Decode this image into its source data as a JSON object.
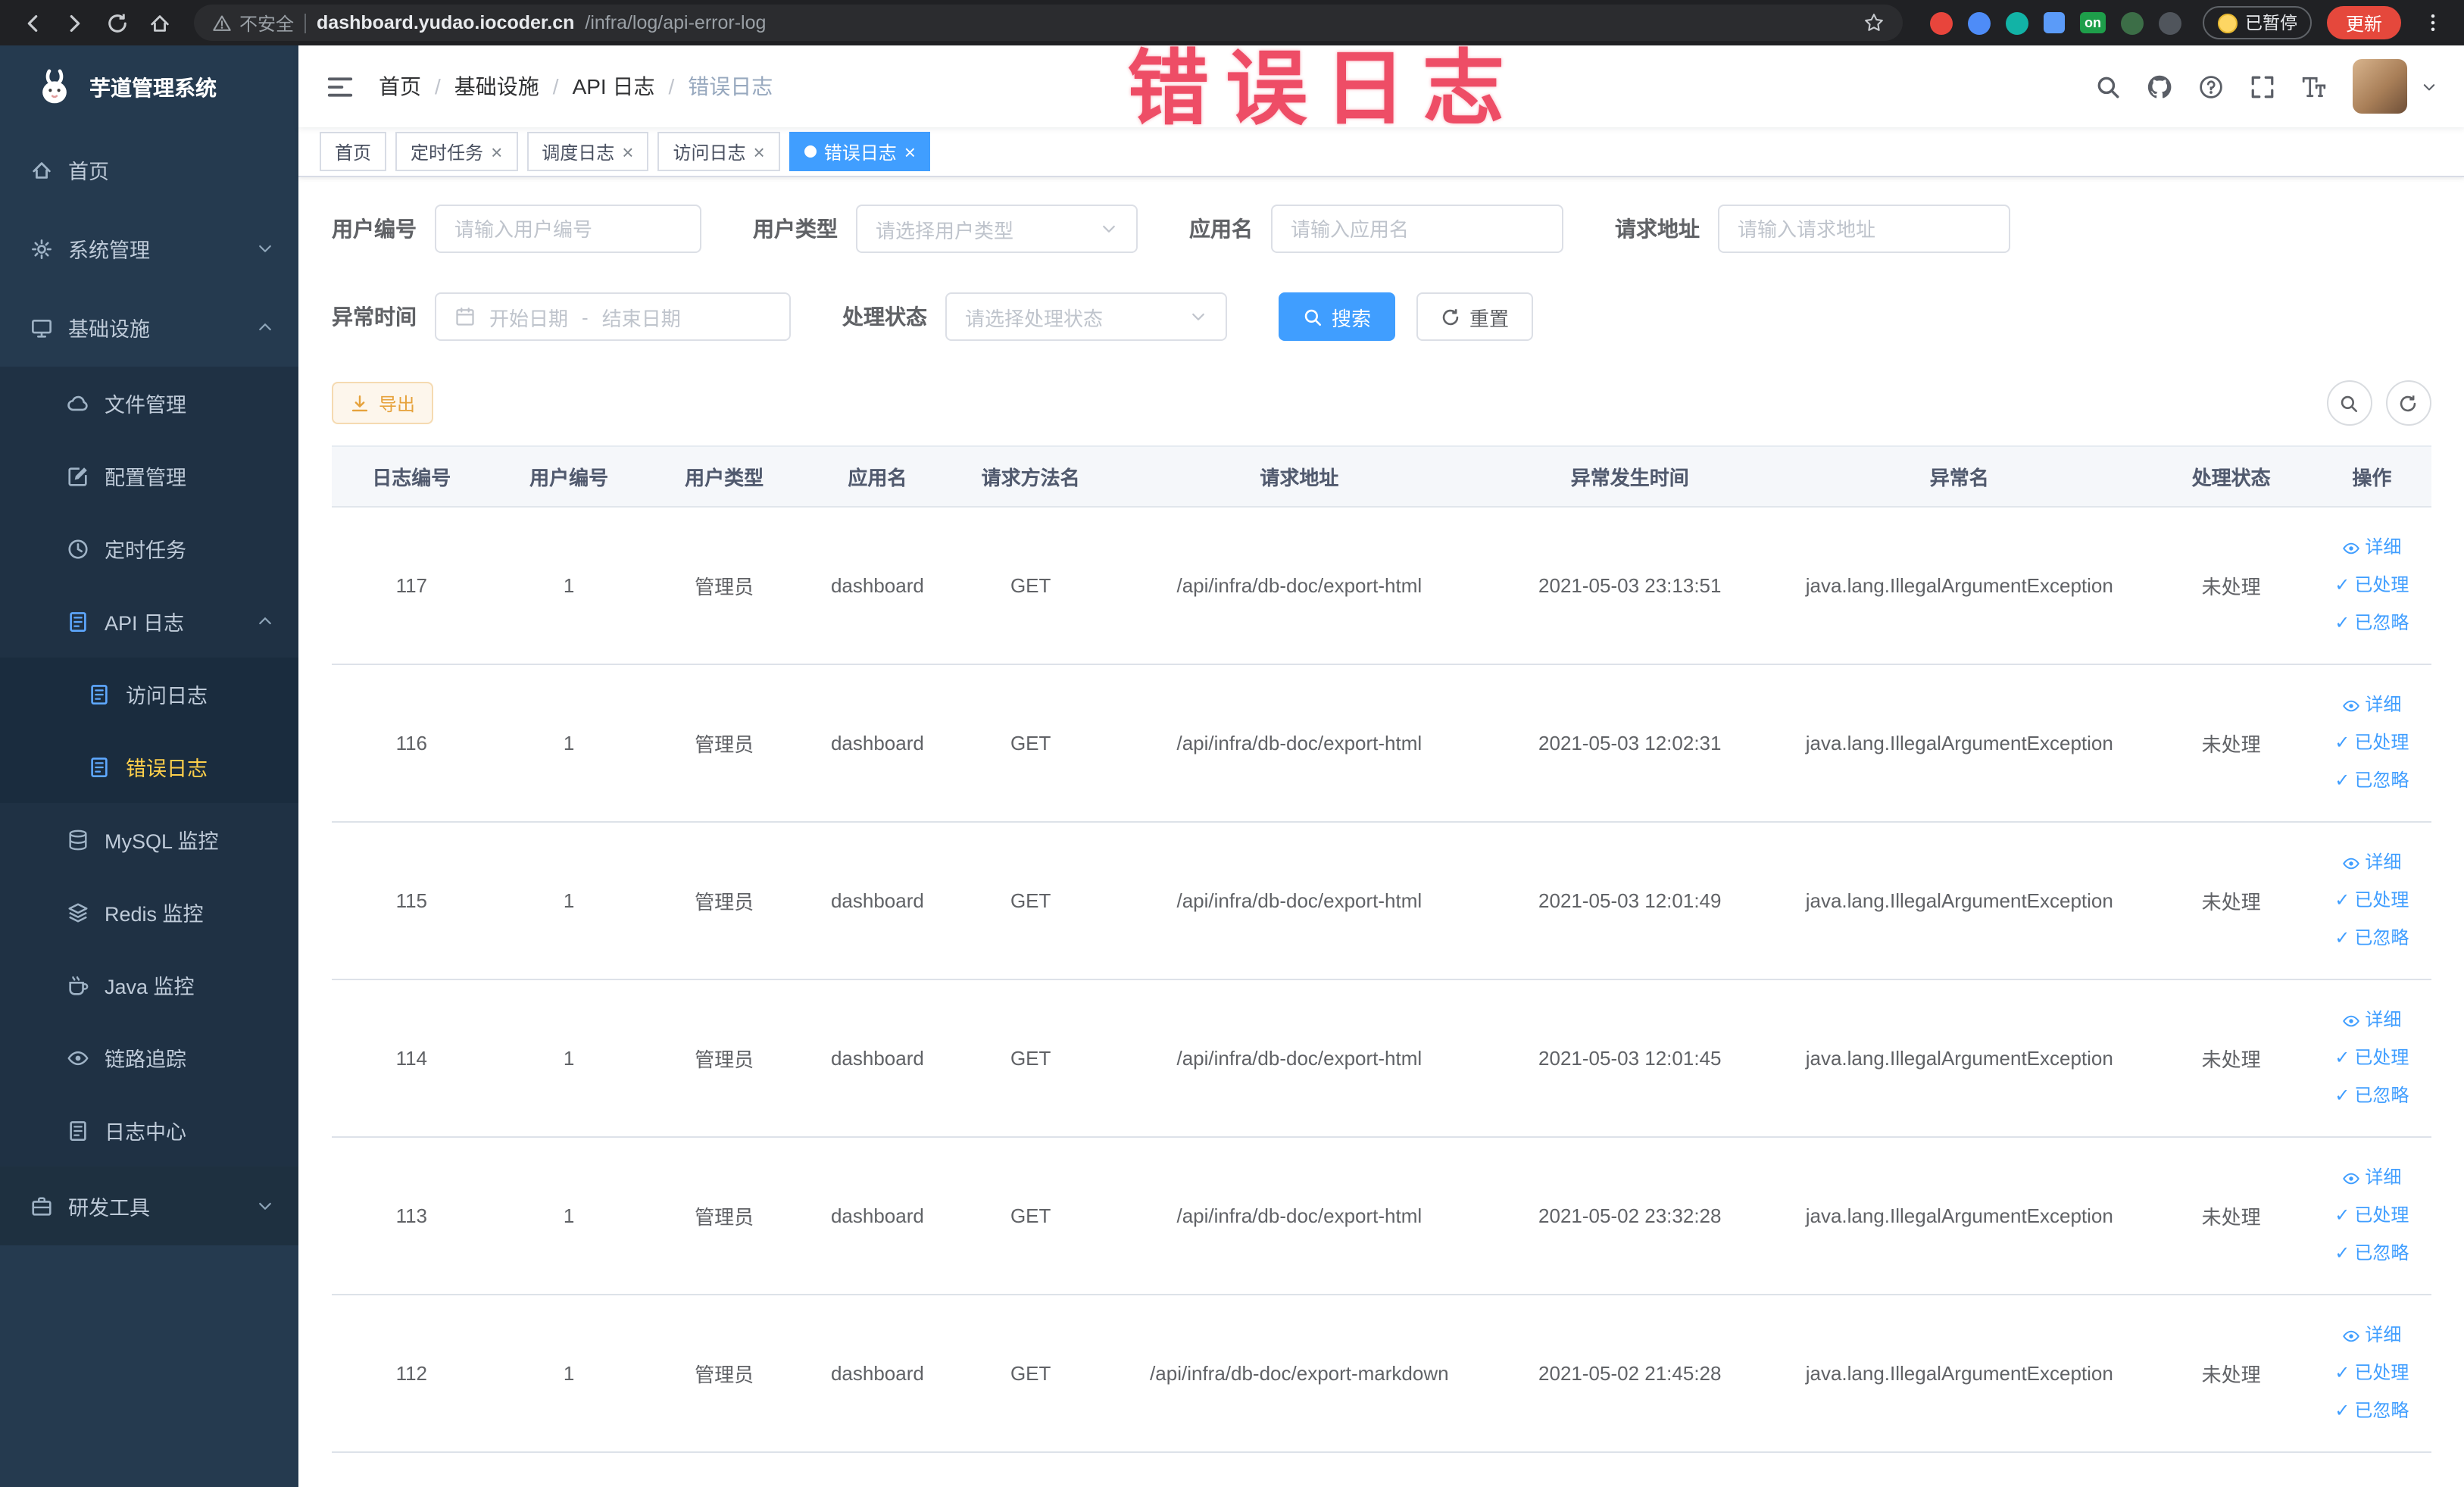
{
  "browser": {
    "not_secure_label": "不安全",
    "url_host": "dashboard.yudao.iocoder.cn",
    "url_path": "/infra/log/api-error-log",
    "extension_on_badge": "on",
    "paused_badge": "已暂停",
    "update_button": "更新"
  },
  "annotation": {
    "text": "错误日志"
  },
  "sidebar": {
    "logo_title": "芋道管理系统",
    "items": [
      {
        "label": "首页"
      },
      {
        "label": "系统管理"
      },
      {
        "label": "基础设施"
      },
      {
        "label": "文件管理"
      },
      {
        "label": "配置管理"
      },
      {
        "label": "定时任务"
      },
      {
        "label": "API 日志"
      },
      {
        "label": "访问日志"
      },
      {
        "label": "错误日志"
      },
      {
        "label": "MySQL 监控"
      },
      {
        "label": "Redis 监控"
      },
      {
        "label": "Java 监控"
      },
      {
        "label": "链路追踪"
      },
      {
        "label": "日志中心"
      },
      {
        "label": "研发工具"
      }
    ]
  },
  "breadcrumb": [
    "首页",
    "基础设施",
    "API 日志",
    "错误日志"
  ],
  "breadcrumb_separator": "/",
  "tabs": [
    {
      "label": "首页"
    },
    {
      "label": "定时任务"
    },
    {
      "label": "调度日志"
    },
    {
      "label": "访问日志"
    },
    {
      "label": "错误日志"
    }
  ],
  "filters": {
    "user_id": {
      "label": "用户编号",
      "placeholder": "请输入用户编号"
    },
    "user_type": {
      "label": "用户类型",
      "placeholder": "请选择用户类型"
    },
    "app_name": {
      "label": "应用名",
      "placeholder": "请输入应用名"
    },
    "request_url": {
      "label": "请求地址",
      "placeholder": "请输入请求地址"
    },
    "exception_time": {
      "label": "异常时间",
      "start_placeholder": "开始日期",
      "separator": "-",
      "end_placeholder": "结束日期"
    },
    "process_status": {
      "label": "处理状态",
      "placeholder": "请选择处理状态"
    },
    "search_button": "搜索",
    "reset_button": "重置"
  },
  "toolbar": {
    "export_button": "导出"
  },
  "table": {
    "columns": [
      "日志编号",
      "用户编号",
      "用户类型",
      "应用名",
      "请求方法名",
      "请求地址",
      "异常发生时间",
      "异常名",
      "处理状态",
      "操作"
    ],
    "actions": [
      "详细",
      "已处理",
      "已忽略"
    ],
    "rows": [
      {
        "id": "117",
        "user_id": "1",
        "user_type": "管理员",
        "app": "dashboard",
        "method": "GET",
        "url": "/api/infra/db-doc/export-html",
        "time": "2021-05-03 23:13:51",
        "exception": "java.lang.IllegalArgumentException",
        "status": "未处理"
      },
      {
        "id": "116",
        "user_id": "1",
        "user_type": "管理员",
        "app": "dashboard",
        "method": "GET",
        "url": "/api/infra/db-doc/export-html",
        "time": "2021-05-03 12:02:31",
        "exception": "java.lang.IllegalArgumentException",
        "status": "未处理"
      },
      {
        "id": "115",
        "user_id": "1",
        "user_type": "管理员",
        "app": "dashboard",
        "method": "GET",
        "url": "/api/infra/db-doc/export-html",
        "time": "2021-05-03 12:01:49",
        "exception": "java.lang.IllegalArgumentException",
        "status": "未处理"
      },
      {
        "id": "114",
        "user_id": "1",
        "user_type": "管理员",
        "app": "dashboard",
        "method": "GET",
        "url": "/api/infra/db-doc/export-html",
        "time": "2021-05-03 12:01:45",
        "exception": "java.lang.IllegalArgumentException",
        "status": "未处理"
      },
      {
        "id": "113",
        "user_id": "1",
        "user_type": "管理员",
        "app": "dashboard",
        "method": "GET",
        "url": "/api/infra/db-doc/export-html",
        "time": "2021-05-02 23:32:28",
        "exception": "java.lang.IllegalArgumentException",
        "status": "未处理"
      },
      {
        "id": "112",
        "user_id": "1",
        "user_type": "管理员",
        "app": "dashboard",
        "method": "GET",
        "url": "/api/infra/db-doc/export-markdown",
        "time": "2021-05-02 21:45:28",
        "exception": "java.lang.IllegalArgumentException",
        "status": "未处理"
      }
    ]
  },
  "icons": {
    "check": "✓",
    "close": "×"
  },
  "colors": {
    "accent": "#409eff",
    "menu_active_text": "#ffd04b",
    "annotation": "#ee4d66",
    "warning_button": "#e6a23c",
    "sidebar_bg": "#253a4f"
  }
}
